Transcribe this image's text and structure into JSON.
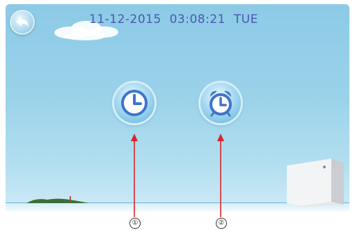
{
  "status_bar": {
    "date": "11-12-2015",
    "time": "03:08:21",
    "weekday": "TUE"
  },
  "buttons": {
    "back": {
      "icon": "back-arrow-icon"
    },
    "clock": {
      "icon": "clock-icon"
    },
    "alarm": {
      "icon": "alarm-clock-icon"
    }
  },
  "callouts": [
    {
      "label": "①",
      "target": "clock-button"
    },
    {
      "label": "②",
      "target": "alarm-button"
    }
  ],
  "colors": {
    "sky": "#8ccae6",
    "datetime_text": "#4d56b4",
    "arrow": "#d9252a",
    "icon_blue": "#3f74c9"
  }
}
